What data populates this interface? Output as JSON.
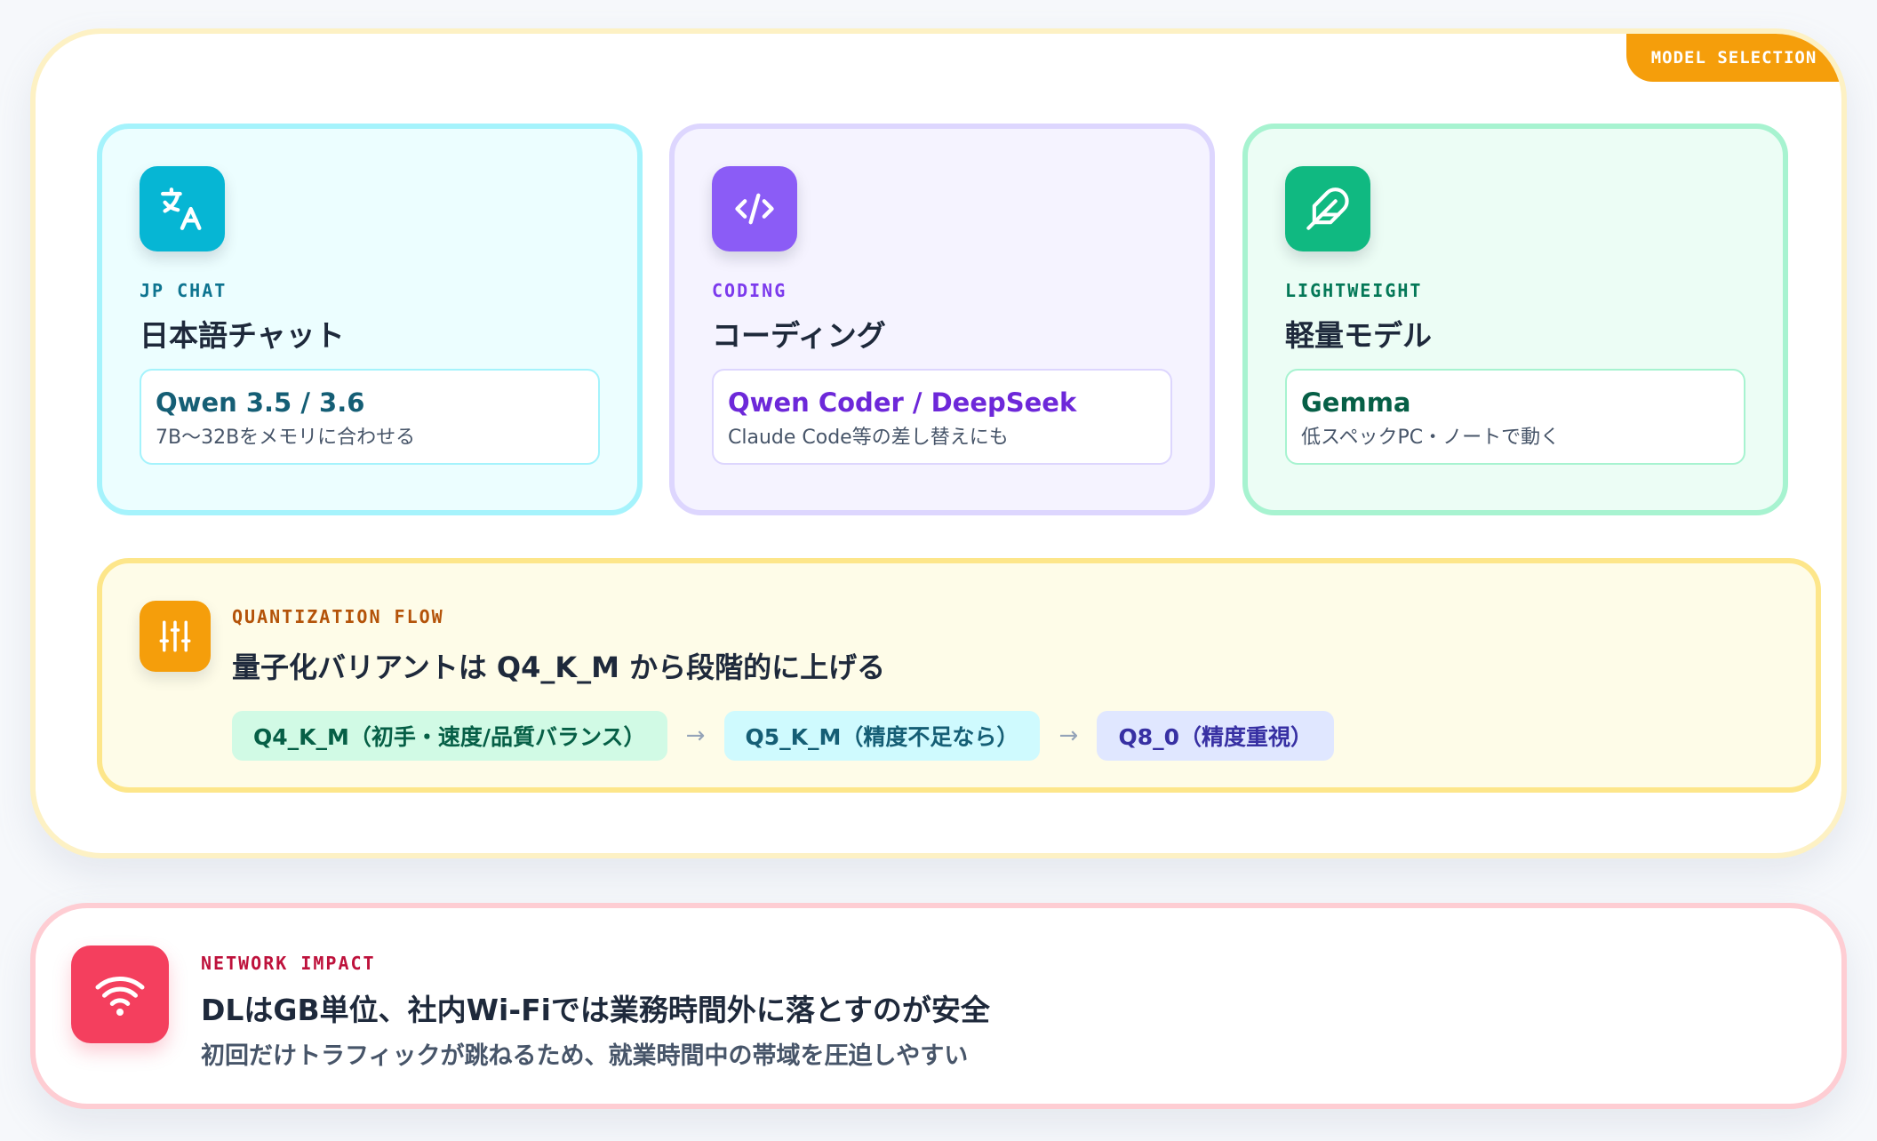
{
  "model_selection": {
    "badge": "MODEL SELECTION",
    "cards": [
      {
        "tag": "JP CHAT",
        "title": "日本語チャット",
        "icon": "translate-icon",
        "model": "Qwen 3.5 / 3.6",
        "desc": "7B〜32Bをメモリに合わせる",
        "color": "#06b6d4"
      },
      {
        "tag": "CODING",
        "title": "コーディング",
        "icon": "code-icon",
        "model": "Qwen Coder / DeepSeek",
        "desc": "Claude Code等の差し替えにも",
        "color": "#8b5cf6"
      },
      {
        "tag": "LIGHTWEIGHT",
        "title": "軽量モデル",
        "icon": "feather-icon",
        "model": "Gemma",
        "desc": "低スペックPC・ノートで動く",
        "color": "#10b981"
      }
    ],
    "quantization": {
      "tag": "QUANTIZATION FLOW",
      "title": "量子化バリアントは Q4_K_M から段階的に上げる",
      "icon": "sliders-icon",
      "steps": [
        "Q4_K_M（初手・速度/品質バランス）",
        "Q5_K_M（精度不足なら）",
        "Q8_0（精度重視）"
      ],
      "arrow": "→",
      "color": "#f59e0b"
    }
  },
  "network_impact": {
    "tag": "NETWORK IMPACT",
    "title": "DLはGB単位、社内Wi-Fiでは業務時間外に落とすのが安全",
    "desc": "初回だけトラフィックが跳ねるため、就業時間中の帯域を圧迫しやすい",
    "icon": "wifi-icon",
    "color": "#f43f5e"
  }
}
